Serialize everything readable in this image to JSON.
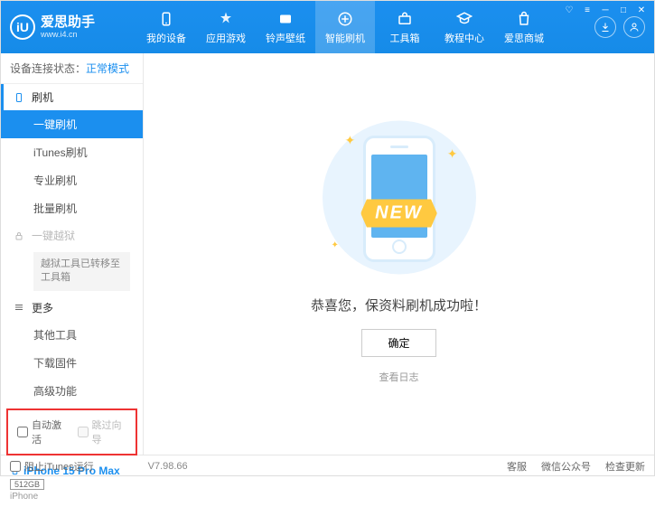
{
  "brand": {
    "title": "爱思助手",
    "url": "www.i4.cn",
    "logo_letter": "iU"
  },
  "nav": [
    {
      "label": "我的设备",
      "icon": "device"
    },
    {
      "label": "应用游戏",
      "icon": "apps"
    },
    {
      "label": "铃声壁纸",
      "icon": "ringtone"
    },
    {
      "label": "智能刷机",
      "icon": "flash",
      "active": true
    },
    {
      "label": "工具箱",
      "icon": "toolbox"
    },
    {
      "label": "教程中心",
      "icon": "tutorial"
    },
    {
      "label": "爱思商城",
      "icon": "store"
    }
  ],
  "sidebar": {
    "status_label": "设备连接状态：",
    "status_value": "正常模式",
    "flash_section": "刷机",
    "flash_items": [
      "一键刷机",
      "iTunes刷机",
      "专业刷机",
      "批量刷机"
    ],
    "jailbreak_head": "一键越狱",
    "jailbreak_note": "越狱工具已转移至工具箱",
    "more_head": "更多",
    "more_items": [
      "其他工具",
      "下载固件",
      "高级功能"
    ],
    "checkboxes": {
      "auto_activate": "自动激活",
      "skip_guide": "跳过向导"
    },
    "device": {
      "name": "iPhone 15 Pro Max",
      "storage": "512GB",
      "type": "iPhone"
    }
  },
  "main": {
    "new_label": "NEW",
    "success_msg": "恭喜您，保资料刷机成功啦！",
    "ok_button": "确定",
    "view_log": "查看日志"
  },
  "footer": {
    "block_itunes": "阻止iTunes运行",
    "version": "V7.98.66",
    "links": [
      "客服",
      "微信公众号",
      "检查更新"
    ]
  }
}
